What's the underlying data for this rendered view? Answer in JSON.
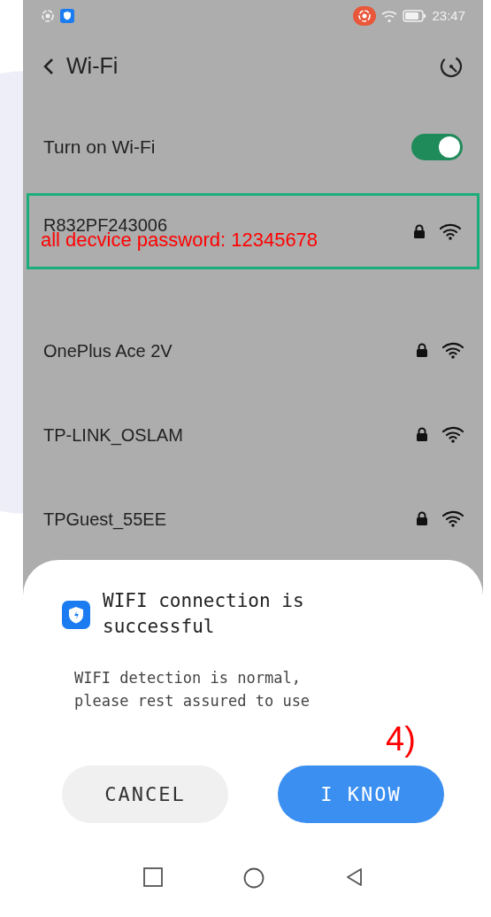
{
  "status_bar": {
    "time": "23:47"
  },
  "header": {
    "title": "Wi-Fi"
  },
  "wifi_toggle": {
    "label": "Turn on Wi-Fi",
    "on": true
  },
  "connected_network": {
    "name": "R832PF243006",
    "locked": true,
    "selected": true
  },
  "annotation": "all decvice password: 12345678",
  "networks": [
    {
      "name": "OnePlus Ace 2V",
      "locked": true
    },
    {
      "name": "TP-LINK_OSLAM",
      "locked": true
    },
    {
      "name": "TPGuest_55EE",
      "locked": true
    }
  ],
  "dialog": {
    "title": "WIFI connection is successful",
    "message": "WIFI detection is normal, please rest assured to use",
    "step_label": "4)",
    "buttons": [
      {
        "label": "CANCEL",
        "kind": "secondary"
      },
      {
        "label": "I KNOW",
        "kind": "primary"
      }
    ]
  }
}
